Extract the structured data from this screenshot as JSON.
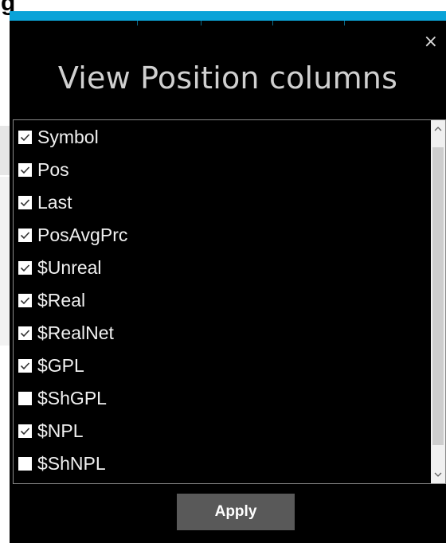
{
  "background": {
    "partial_glyph": "g"
  },
  "dialog": {
    "title": "View Position columns",
    "close_label": "×",
    "accent_color": "#0aa3d8",
    "columns": [
      {
        "label": "Symbol",
        "checked": true
      },
      {
        "label": "Pos",
        "checked": true
      },
      {
        "label": "Last",
        "checked": true
      },
      {
        "label": "PosAvgPrc",
        "checked": true
      },
      {
        "label": "$Unreal",
        "checked": true
      },
      {
        "label": "$Real",
        "checked": true
      },
      {
        "label": "$RealNet",
        "checked": true
      },
      {
        "label": "$GPL",
        "checked": true
      },
      {
        "label": "$ShGPL",
        "checked": false
      },
      {
        "label": "$NPL",
        "checked": true
      },
      {
        "label": "$ShNPL",
        "checked": false
      }
    ],
    "apply_label": "Apply"
  }
}
